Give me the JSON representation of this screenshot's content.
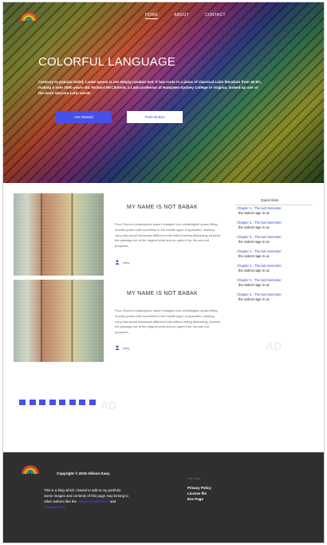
{
  "nav": {
    "items": [
      {
        "label": "HOME",
        "active": true
      },
      {
        "label": "ABOUT",
        "active": false
      },
      {
        "label": "CONTACT",
        "active": false
      }
    ]
  },
  "hero": {
    "title": "COLORFUL LANGUAGE",
    "text": "Contrary to popular belief, Lorem Ipsum is not simply random text. It has roots in a piece of classical Latin literature from 45 BC, making it over 2000 years old. Richard McClintock, a Latin professor at Hampden-Sydney College in Virginia, looked up one of the more obscure Latin words",
    "primary_button": "Get Started",
    "secondary_button": "Push Button"
  },
  "posts": [
    {
      "title": "MY NAME IS NOT BABAK",
      "body": "Poor Cicero's masterpiece wasn't mangled into unintelligible space-filling mumbo-jumbo with sometime in the middle ages. A typesetter, seeking copy that would showcase different fonts without being distracting, plucked the passage out of the original work and co-opted it for his own evil purposes.",
      "author": "kaey"
    },
    {
      "title": "MY NAME IS NOT BABAK",
      "body": "Poor Cicero's masterpiece wasn't mangled into unintelligible space-filling mumbo-jumbo with sometime in the middle ages. A typesetter, seeking copy that would showcase different fonts without being distracting, plucked the passage out of the original work and co-opted it for his own evil purposes.",
      "author": "kaey"
    }
  ],
  "sidebar": {
    "title": "Quick links",
    "links": [
      {
        "label": "Chapter 1...The last Semester",
        "sub": "the violent rage in us"
      },
      {
        "label": "Chapter 2...The last Semester",
        "sub": "the violent rage in us"
      },
      {
        "label": "Chapter 3...The last Semester",
        "sub": "the violent rage in us"
      },
      {
        "label": "Chapter 2...The last Semester",
        "sub": "the violent rage in us"
      },
      {
        "label": "Chapter 2...The last Semester",
        "sub": "the violent rage in us"
      },
      {
        "label": "Chapter 2...The last Semester",
        "sub": "the violent rage in us"
      },
      {
        "label": "Chapter 2...The last Semester",
        "sub": "the violent rage in us"
      }
    ]
  },
  "ads": [
    "AD",
    "AD"
  ],
  "pagination": {
    "count": 8
  },
  "footer": {
    "copyright": "Copyright © 2019 Allison Kaey",
    "about_text": "This is a blog which I intend to add to my portfolio. Some images and contents of this page may belong to other authors like the",
    "about_link1": "company-portfolio.io",
    "about_and": "and",
    "about_link2": "unsplash.com",
    "links_label": "Site links",
    "links": [
      "Privacy Policy",
      "License file",
      "Env Page"
    ]
  },
  "colors": {
    "accent": "#4750e8",
    "footer_bg": "#2f2f2f",
    "link": "#3a48c9"
  },
  "icons": [
    "rainbow-logo-icon",
    "user-icon"
  ]
}
